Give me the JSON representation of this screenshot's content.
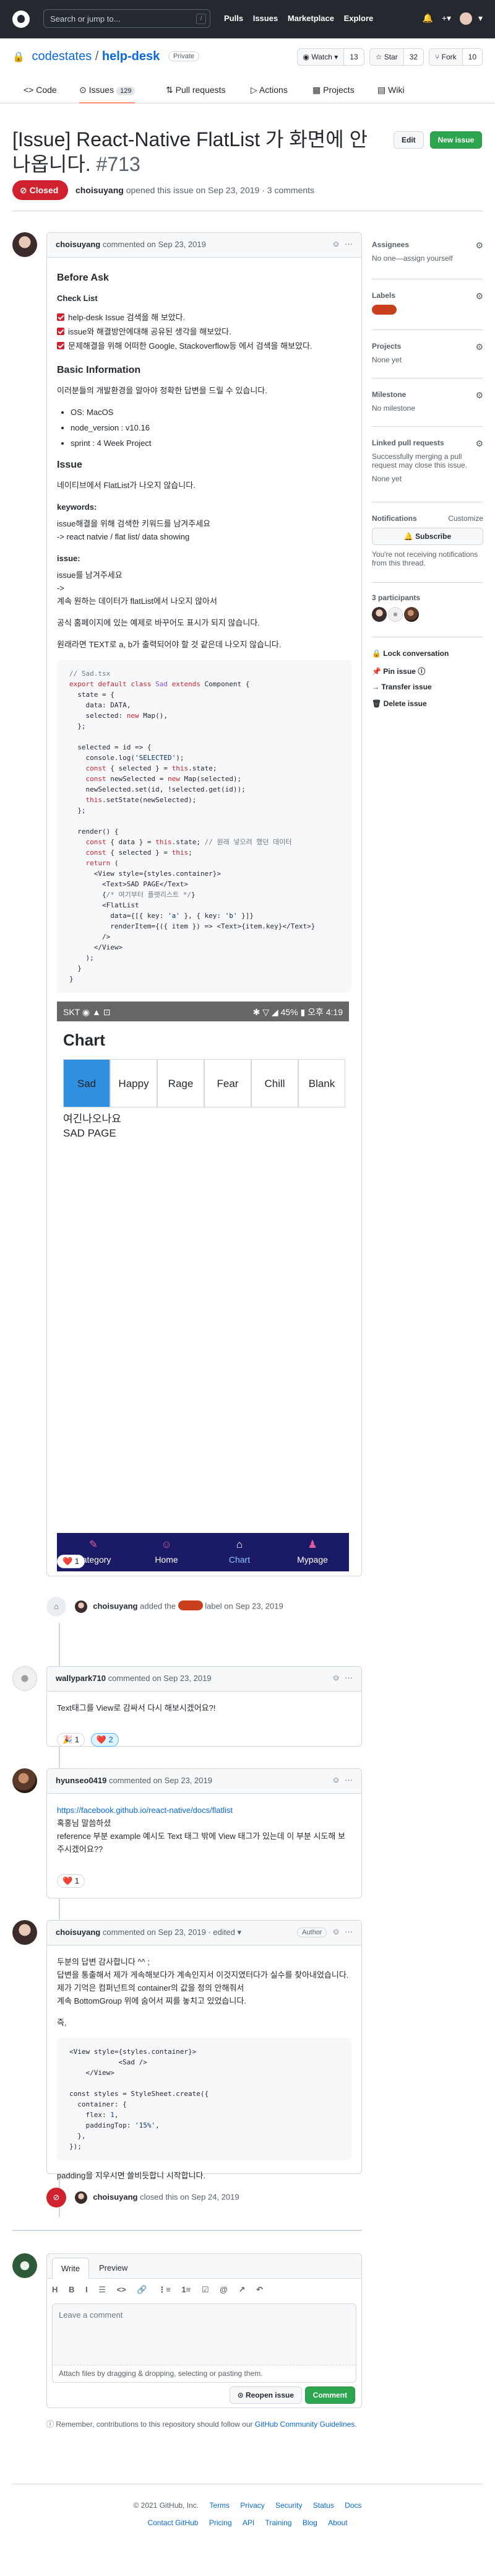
{
  "header": {
    "search_placeholder": "Search or jump to...",
    "search_key": "/",
    "nav": [
      "Pulls",
      "Issues",
      "Marketplace",
      "Explore"
    ],
    "right_icons": [
      "bell-icon",
      "plus-icon",
      "user-avatar"
    ]
  },
  "repo": {
    "owner": "codestates",
    "separator": "/",
    "name": "help-desk",
    "visibility": "Private",
    "watch_label": "Watch",
    "watch_count": "13",
    "star_label": "Star",
    "star_count": "32",
    "fork_label": "Fork",
    "fork_count": "10"
  },
  "tabs": [
    {
      "label": "Code",
      "icon": "code-icon"
    },
    {
      "label": "Issues",
      "icon": "issue-icon",
      "count": "129"
    },
    {
      "label": "Pull requests",
      "icon": "pr-icon"
    },
    {
      "label": "Actions",
      "icon": "actions-icon"
    },
    {
      "label": "Projects",
      "icon": "projects-icon"
    },
    {
      "label": "Wiki",
      "icon": "wiki-icon"
    }
  ],
  "issue": {
    "title": "[Issue] React-Native FlatList 가 화면에 안나옵니다.",
    "number": "#713",
    "edit_label": "Edit",
    "new_issue_label": "New issue",
    "state": "Closed",
    "author": "choisuyang",
    "opened_text": "opened this issue on Sep 23, 2019 · 3 comments"
  },
  "first_comment": {
    "author": "choisuyang",
    "date": "commented on Sep 23, 2019",
    "before_ask": "Before Ask",
    "checklist_title": "Check List",
    "checklist": [
      "help-desk Issue 검색을 해 보았다.",
      "issue와 해결방안에대해 공유된 생각을 해보았다.",
      "문제해결을 위해 어떠한 Google, Stackoverflow등 에서 검색을 해보았다."
    ],
    "basic_info_title": "Basic Information",
    "basic_info_desc": "이러분들의 개발환경을 알아야 정확한 답변을 드릴 수 있습니다.",
    "basic_info": [
      "OS: MacOS",
      "node_version : v10.16",
      "sprint : 4 Week Project"
    ],
    "issue_title": "Issue",
    "issue_desc": "네이티브에서 FlatList가 나오지 않습니다.",
    "keywords_title": "keywords:",
    "keywords_desc1": "issue해결을 위해 검색한 키워드를 남겨주세요",
    "keywords_desc2": "-> react natvie / flat list/ data showing",
    "issue2_title": "issue:",
    "issue2_desc1": "issue를 남겨주세요",
    "issue2_desc2": "->",
    "issue2_desc3": "계속 원하는 데이터가 flatList에서 나오지 않아서",
    "issue2_desc4": "공식 홈페이지에 있는 예제로 바꾸어도 표시가 되지 않습니다.",
    "issue2_desc5": "원래라면 TEXT로 a, b가 출력되어야 할 것 같은데 나오지 않습니다.",
    "phone": {
      "status_left": "SKT ◉ ▲ ⊡",
      "status_right": "✱ ▽ ◢ 45% ▮ 오후 4:19",
      "title": "Chart",
      "emotions": [
        "Sad",
        "Happy",
        "Rage",
        "Fear",
        "Chill",
        "Blank"
      ],
      "selected_emotion": "Sad",
      "sub1": "여긴나오나요",
      "sub2": "SAD PAGE",
      "tabbar": [
        {
          "label": "Category",
          "icon": "feather-icon"
        },
        {
          "label": "Home",
          "icon": "emoji-icon"
        },
        {
          "label": "Chart",
          "icon": "home-icon"
        },
        {
          "label": "Mypage",
          "icon": "person-icon"
        }
      ],
      "selected_tab": "Chart"
    },
    "reaction": "❤️ 1"
  },
  "event_label": {
    "author": "choisuyang",
    "text1": "added the",
    "text2": "label on Sep 23, 2019"
  },
  "comment_wally": {
    "author": "wallypark710",
    "date": "commented on Sep 23, 2019",
    "body": "Text태그를 View로 감싸서 다시 해보시겠어요?!",
    "reactions": [
      "🎉 1",
      "❤️ 2"
    ]
  },
  "comment_hyun": {
    "author": "hyunseo0419",
    "date": "commented on Sep 23, 2019",
    "link": "https://facebook.github.io/react-native/docs/flatlist",
    "line2": "혹홍님 말씀하셨",
    "line3": "reference 부분 example 예시도 Text 태그 밖에 View 태그가 있는데 이 부분 시도해 보주시겠어요??",
    "reaction": "❤️ 1"
  },
  "comment_choi2": {
    "author": "choisuyang",
    "date": "commented on Sep 23, 2019 · edited",
    "badge": "Author",
    "p1": "두분의 답변 감사합니다 ^^ ;",
    "p2": "답변을 통출해서 제가 게속해보다가 계속인지서 이것지였터다가 실수를 찾아내었습니다.",
    "p3": "제가 기억은 컴퍼넌트의 container의 값을 정의 안해줘서",
    "p4": "계속 BottomGroup 위에 숨어서 찌를 놓치고 있었습니다.",
    "p5": "즉,",
    "p6": "padding을 지우시면 쓸비듯합니 시작합니다."
  },
  "event_closed": {
    "author": "choisuyang",
    "text": "closed this on Sep 24, 2019"
  },
  "reply": {
    "write_tab": "Write",
    "preview_tab": "Preview",
    "placeholder": "Leave a comment",
    "attach": "Attach files by dragging & dropping, selecting or pasting them.",
    "reopen_label": "Reopen issue",
    "comment_label": "Comment",
    "toolbar": [
      "H",
      "B",
      "I",
      "☰",
      "<>",
      "🔗",
      "⋮≡",
      "1≡",
      "☑",
      "@",
      "↗",
      "↶"
    ]
  },
  "remember": {
    "text": "Remember, contributions to this repository should follow our",
    "link": "GitHub Community Guidelines",
    "end": "."
  },
  "sidebar": {
    "assignees_title": "Assignees",
    "assignees_value": "No one—assign yourself",
    "labels_title": "Labels",
    "projects_title": "Projects",
    "projects_value": "None yet",
    "milestone_title": "Milestone",
    "milestone_value": "No milestone",
    "linked_title": "Linked pull requests",
    "linked_desc": "Successfully merging a pull request may close this issue.",
    "linked_value": "None yet",
    "notifications_title": "Notifications",
    "customize": "Customize",
    "subscribe": "Subscribe",
    "notif_desc": "You're not receiving notifications from this thread.",
    "participants_title": "3 participants",
    "lock": "Lock conversation",
    "pin": "Pin issue",
    "transfer": "Transfer issue",
    "delete": "Delete issue"
  },
  "footer": {
    "row1": [
      "© 2021 GitHub, Inc.",
      "Terms",
      "Privacy",
      "Security",
      "Status",
      "Docs"
    ],
    "row2": [
      "Contact GitHub",
      "Pricing",
      "API",
      "Training",
      "Blog",
      "About"
    ]
  },
  "colors": {
    "closed_red": "#cf222e",
    "label_orange": "#c9401d",
    "phone_selected": "#2f8fe0",
    "tabbar_navy": "#1a1a66"
  }
}
